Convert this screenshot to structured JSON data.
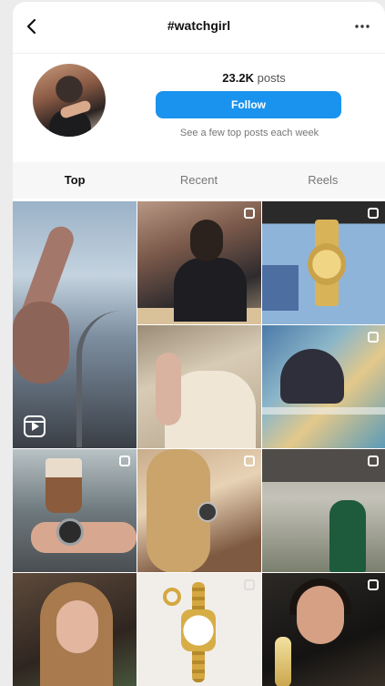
{
  "header": {
    "title": "#watchgirl",
    "back_icon": "chevron-left-icon",
    "more_icon": "more-horizontal-icon"
  },
  "profile": {
    "posts_count": "23.2K",
    "posts_label": "posts",
    "follow_label": "Follow",
    "hint": "See a few top posts each week"
  },
  "tabs": [
    {
      "label": "Top",
      "active": true
    },
    {
      "label": "Recent",
      "active": false
    },
    {
      "label": "Reels",
      "active": false
    }
  ],
  "colors": {
    "follow_blue": "#1a93ee",
    "tab_bg": "#f7f7f7"
  }
}
